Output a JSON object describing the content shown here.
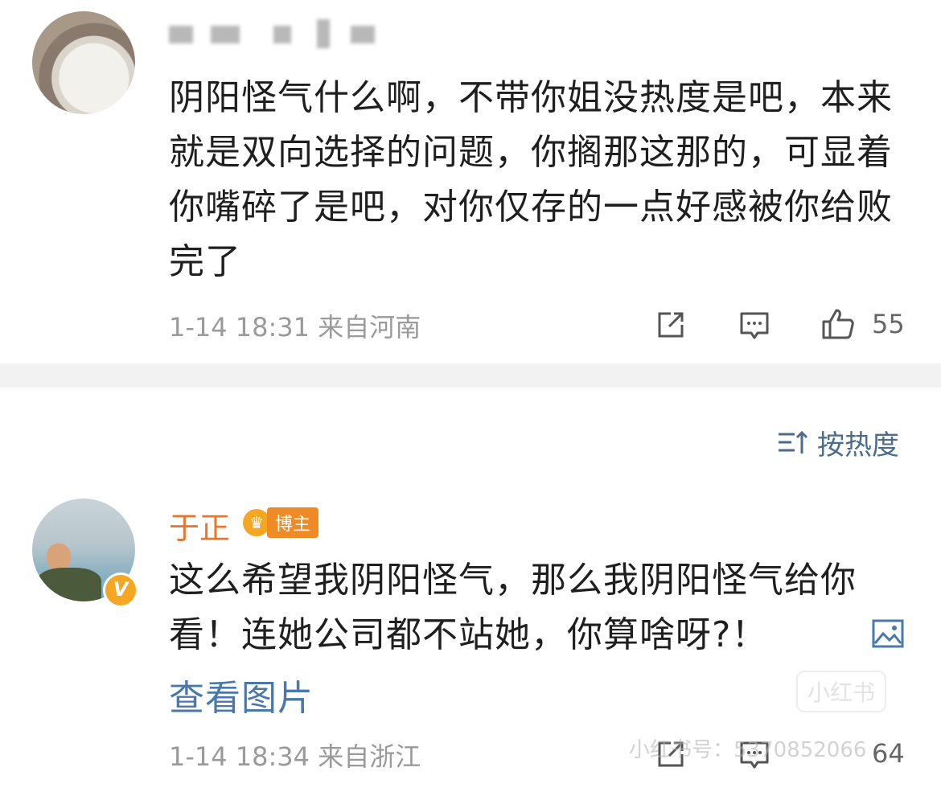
{
  "comment1": {
    "text": "阴阳怪气什么啊，不带你姐没热度是吧，本来就是双向选择的问题，你搁那这那的，可显着你嘴碎了是吧，对你仅存的一点好感被你给败完了",
    "time": "1-14 18:31",
    "location": "来自河南",
    "likes": "55"
  },
  "sort": {
    "label": "按热度"
  },
  "comment2": {
    "author": "于正",
    "badge": "博主",
    "text": "这么希望我阴阳怪气，那么我阴阳怪气给你看！连她公司都不站她，你算啥呀?！",
    "view_pic_label": "查看图片",
    "time": "1-14 18:34",
    "location": "来自浙江",
    "likes": "64"
  },
  "watermark": {
    "logo": "小红书",
    "id_text": "小红书号：5370852066"
  },
  "colors": {
    "author_name": "#e8772e",
    "link": "#4a78a8",
    "meta": "#9a9a9a",
    "divider": "#f2f2f2"
  }
}
